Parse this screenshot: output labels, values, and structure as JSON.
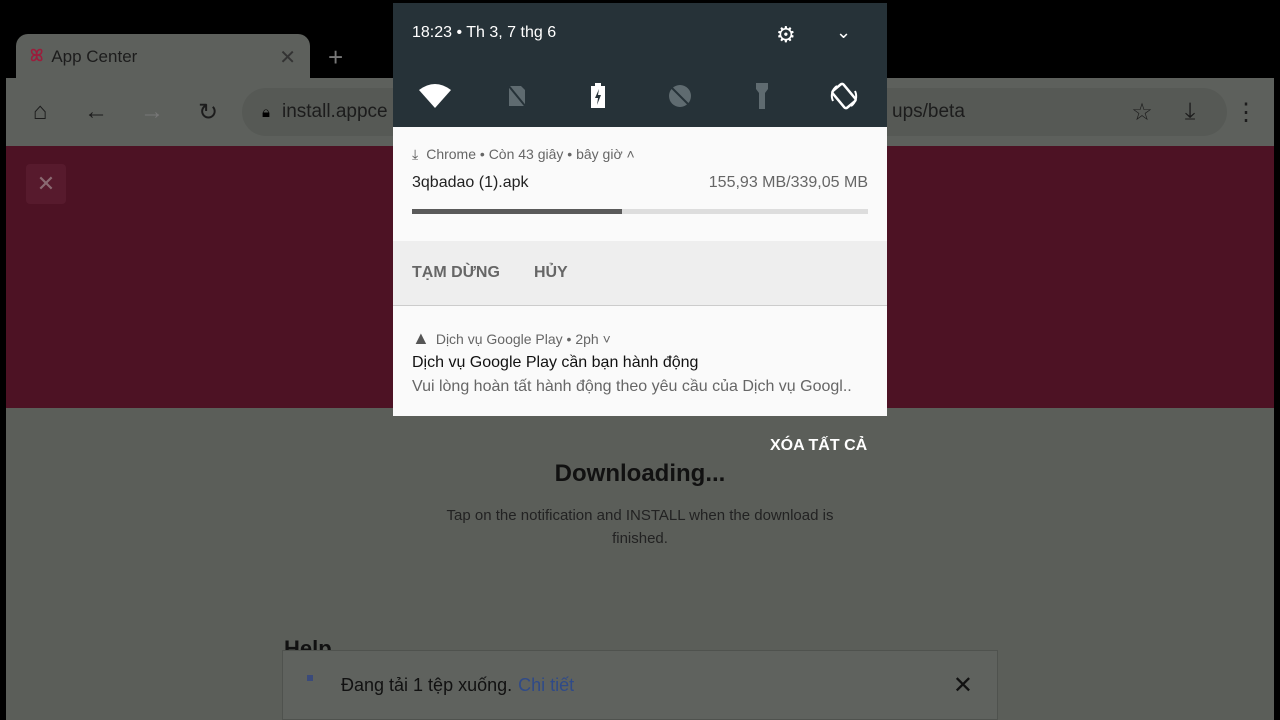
{
  "browser": {
    "tab_title": "App Center",
    "tab_logo": "app-center-logo",
    "url_start": "install.appce",
    "url_end": "ups/beta"
  },
  "page": {
    "heading": "Downloading...",
    "description": "Tap on the notification and INSTALL when the download is finished.",
    "help_heading": "Help",
    "hero_color": "#4d1224"
  },
  "snackbar": {
    "message": "Đang tải 1 tệp xuống.",
    "link": "Chi tiết"
  },
  "status": {
    "time": "18:23",
    "date": "Th 3, 7 thg 6",
    "quick_settings": [
      "wifi-icon",
      "no-sim-icon",
      "battery-charging-icon",
      "data-saver-off-icon",
      "flashlight-icon",
      "auto-rotate-icon"
    ]
  },
  "download_notification": {
    "app": "Chrome",
    "remaining": "Còn 43 giây",
    "when": "bây giờ",
    "file": "3qbadao (1).apk",
    "size": "155,93 MB/339,05 MB",
    "progress": 0.46,
    "pause_label": "TẠM DỪNG",
    "cancel_label": "HỦY"
  },
  "play_notification": {
    "app": "Dịch vụ Google Play",
    "when": "2ph",
    "title": "Dịch vụ Google Play cần bạn hành động",
    "body": "Vui lòng hoàn tất hành động theo yêu cầu của Dịch vụ Googl.."
  },
  "clear_all_label": "XÓA TẤT CẢ"
}
